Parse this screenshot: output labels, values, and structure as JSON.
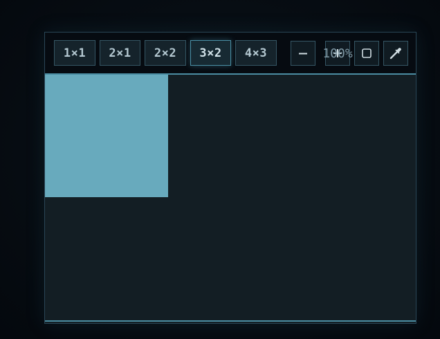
{
  "layouts": [
    {
      "label": "1×1",
      "active": false
    },
    {
      "label": "2×1",
      "active": false
    },
    {
      "label": "2×2",
      "active": false
    },
    {
      "label": "3×2",
      "active": true
    },
    {
      "label": "4×3",
      "active": false
    }
  ],
  "zoom": {
    "readout": "100%",
    "value_percent": 100,
    "decrease_icon": "minus-icon",
    "increase_icon": "plus-icon"
  },
  "tools": {
    "square_icon": "square-icon",
    "eyedropper_icon": "eyedropper-icon"
  },
  "grid": {
    "columns": 3,
    "rows": 2,
    "selected_cell": {
      "row": 1,
      "column": 1
    },
    "selected_color": "#68aabd"
  },
  "colors": {
    "accent": "#4b8ea3",
    "background": "#131e24",
    "toolbar": "#060b11"
  }
}
